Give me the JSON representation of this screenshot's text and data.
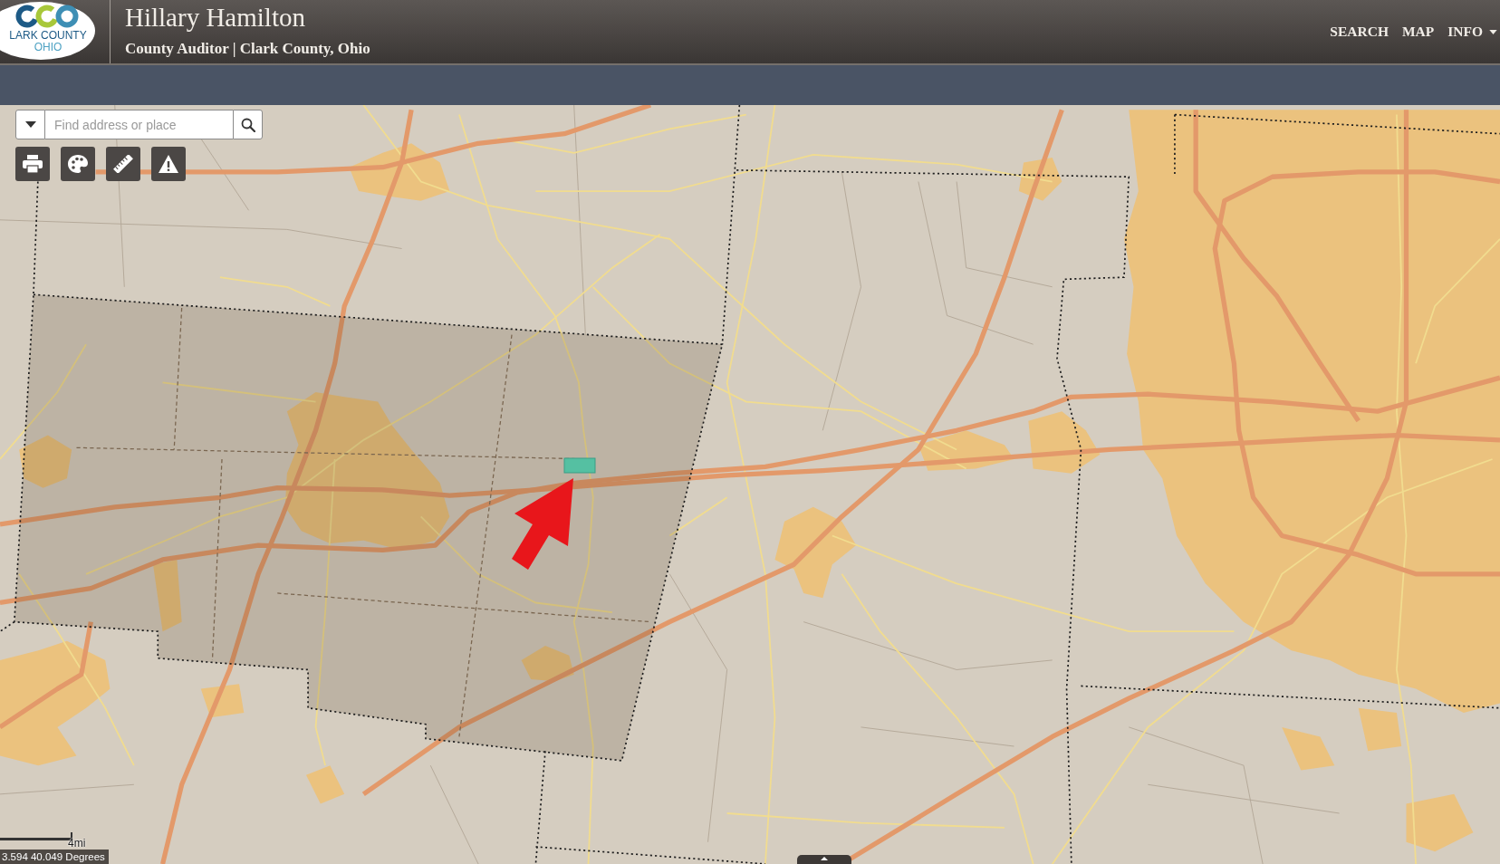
{
  "header": {
    "logo": {
      "line_1": "LARK COUNTY",
      "line_2": "OHIO"
    },
    "title": "Hillary Hamilton",
    "subtitle": "County Auditor | Clark County, Ohio",
    "nav": [
      {
        "label": "SEARCH",
        "kind": "link"
      },
      {
        "label": "MAP",
        "kind": "link"
      },
      {
        "label": "INFO",
        "kind": "dropdown"
      }
    ]
  },
  "search": {
    "placeholder": "Find address or place"
  },
  "tools": [
    {
      "kind": "print"
    },
    {
      "kind": "palette"
    },
    {
      "kind": "ruler"
    },
    {
      "kind": "warning"
    }
  ],
  "scale_bar": {
    "label": "4mi"
  },
  "coordinates": "3.594 40.049 Degrees"
}
